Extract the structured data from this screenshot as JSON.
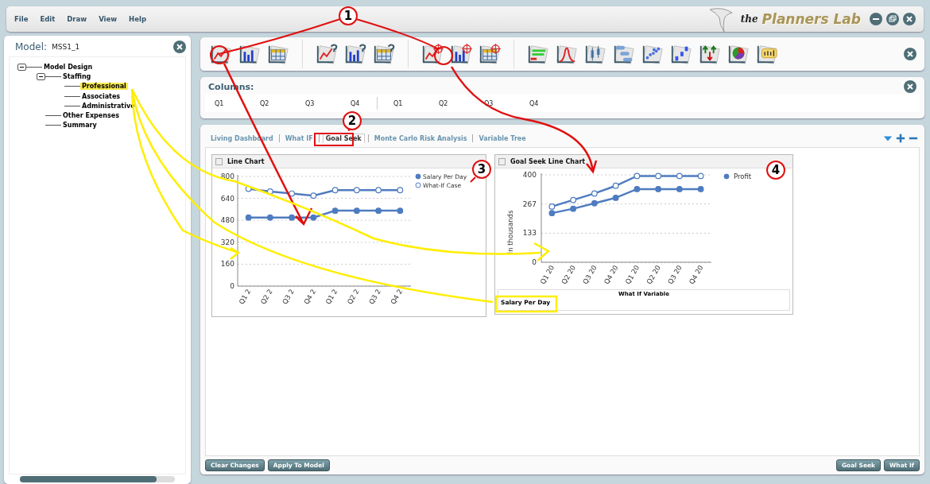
{
  "menu": [
    "File",
    "Edit",
    "Draw",
    "View",
    "Help"
  ],
  "logo": {
    "prefix": "the",
    "name": "Planners Lab"
  },
  "model": {
    "label": "Model:",
    "name": "MSS1_1"
  },
  "tree": [
    {
      "label": "Model Design",
      "expanded": true,
      "selected": false,
      "children": [
        {
          "label": "Staffing",
          "expanded": true,
          "selected": false,
          "children": [
            {
              "label": "Professional",
              "selected": true
            },
            {
              "label": "Associates",
              "selected": false
            },
            {
              "label": "Administrative",
              "selected": false
            }
          ]
        },
        {
          "label": "Other Expenses",
          "selected": false
        },
        {
          "label": "Summary",
          "selected": false
        }
      ]
    }
  ],
  "columns": {
    "title": "Columns:",
    "items": [
      "Q1",
      "Q2",
      "Q3",
      "Q4",
      "Q1",
      "Q2",
      "Q3",
      "Q4"
    ]
  },
  "tabs": [
    {
      "label": "Living Dashboard",
      "selected": false
    },
    {
      "label": "What IF",
      "selected": false
    },
    {
      "label": "Goal Seek",
      "selected": true
    },
    {
      "label": "Monte Carlo Risk Analysis",
      "selected": false
    },
    {
      "label": "Variable Tree",
      "selected": false
    }
  ],
  "charts": [
    {
      "title": "Line Chart",
      "checked": false,
      "chart_data": {
        "type": "line",
        "grid": true,
        "legend": true,
        "categories": [
          "Q1 2",
          "Q2 2",
          "Q3 2",
          "Q4 2",
          "Q1 2",
          "Q2 2",
          "Q3 2",
          "Q4 2"
        ],
        "ylim": [
          0,
          800
        ],
        "yticks": [
          0,
          160,
          320,
          480,
          640,
          800
        ],
        "series": [
          {
            "name": "Salary Per Day",
            "color": "#4f7cc0",
            "marker": "circle",
            "values": [
              500,
              500,
              500,
              500,
              550,
              550,
              550,
              550
            ]
          },
          {
            "name": "What-If Case",
            "color": "#4f7cc0",
            "marker": "circle",
            "values": [
              710,
              690,
              675,
              660,
              700,
              700,
              700,
              700
            ]
          }
        ]
      }
    },
    {
      "title": "Goal Seek Line Chart",
      "checked": false,
      "variable": "Salary Per Day",
      "chart_data": {
        "type": "line",
        "grid": true,
        "legend": true,
        "xlabel": "What If Variable",
        "ylabel": "In thousands",
        "categories": [
          "Q1 20",
          "Q2 20",
          "Q3 20",
          "Q4 20",
          "Q1 20",
          "Q2 20",
          "Q3 20",
          "Q4 20"
        ],
        "ylim": [
          0,
          400
        ],
        "yticks": [
          0,
          133,
          267,
          400
        ],
        "series": [
          {
            "name": "Profit",
            "color": "#4f7cc0",
            "marker": "circle",
            "values": [
              225,
              245,
              270,
              295,
              335,
              335,
              335,
              335
            ]
          },
          {
            "color": "#4f7cc0",
            "marker": "circle",
            "values": [
              255,
              285,
              315,
              350,
              395,
              395,
              395,
              395
            ]
          }
        ]
      }
    }
  ],
  "buttons_left": [
    "Clear Changes",
    "Apply To Model"
  ],
  "buttons_right": [
    "Goal Seek",
    "What If"
  ],
  "callouts": [
    "1",
    "2",
    "3",
    "4"
  ]
}
